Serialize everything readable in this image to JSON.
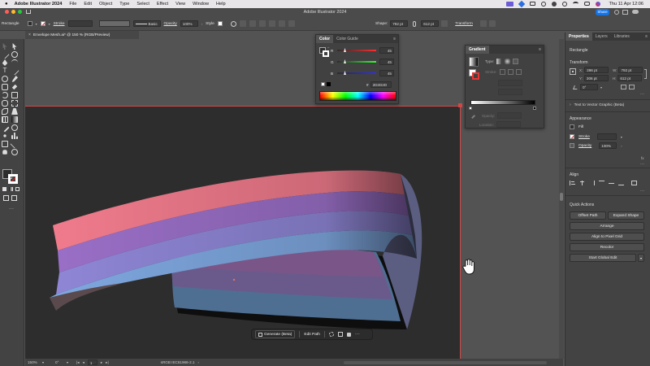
{
  "menubar": {
    "app_name": "Adobe Illustrator 2024",
    "items": [
      "File",
      "Edit",
      "Object",
      "Type",
      "Select",
      "Effect",
      "View",
      "Window",
      "Help"
    ],
    "clock": "Thu 11 Apr  12:06"
  },
  "window": {
    "title": "Adobe Illustrator 2024",
    "share_label": "Share"
  },
  "controlbar": {
    "selection_label": "Rectangle",
    "stroke_label": "Stroke",
    "brush_value": "Basic",
    "opacity_label": "Opacity",
    "opacity_value": "100%",
    "style_label": "Style",
    "shape_label": "Shape:",
    "width_value": "792 pt",
    "height_value": "612 pt",
    "transform_label": "Transform"
  },
  "document_tab": {
    "title": "Envelope Mesh.ai* @ 150 % (RGB/Preview)"
  },
  "color_panel": {
    "tabs": [
      "Color",
      "Color Guide"
    ],
    "channels": [
      {
        "name": "R",
        "value": "45"
      },
      {
        "name": "G",
        "value": "45"
      },
      {
        "name": "B",
        "value": "45"
      }
    ],
    "hex_prefix": "#",
    "hex_value": "2D2D2D"
  },
  "gradient_panel": {
    "tab": "Gradient",
    "type_label": "Type:",
    "stroke_label": "Stroke:",
    "opacity_label": "Opacity:",
    "location_label": "Location:"
  },
  "properties_panel": {
    "tabs": [
      "Properties",
      "Layers",
      "Libraries"
    ],
    "selection": "Rectangle",
    "transform_label": "Transform",
    "x_label": "X:",
    "x_value": "396 pt",
    "y_label": "Y:",
    "y_value": "306 pt",
    "w_label": "W:",
    "w_value": "792 pt",
    "h_label": "H:",
    "h_value": "612 pt",
    "angle_value": "0°",
    "text_to_vector": "Text to Vector Graphic (Beta)",
    "appearance_label": "Appearance",
    "fill_label": "Fill",
    "stroke_label": "Stroke",
    "opacity_label": "Opacity",
    "opacity_value": "100%",
    "align_label": "Align",
    "quick_actions_label": "Quick Actions",
    "buttons": {
      "offset_path": "Offset Path",
      "expand_shape": "Expand Shape",
      "arrange": "Arrange",
      "align_pixel": "Align to Pixel Grid",
      "recolor": "Recolor",
      "start_global_edit": "Start Global Edit"
    }
  },
  "context_bar": {
    "generate": "Generate (Beta)",
    "edit_path": "Edit Path"
  },
  "statusbar": {
    "zoom": "150%",
    "angle": "0°",
    "artboard": "1",
    "profile": "sRGB IEC61966-2.1"
  },
  "colors": {
    "ribbon": [
      "#f07b8c",
      "#9a6fc7",
      "#8f86d6",
      "#7fa8e0"
    ],
    "accent": "#1473e6",
    "artboard_border": "#d04848"
  }
}
